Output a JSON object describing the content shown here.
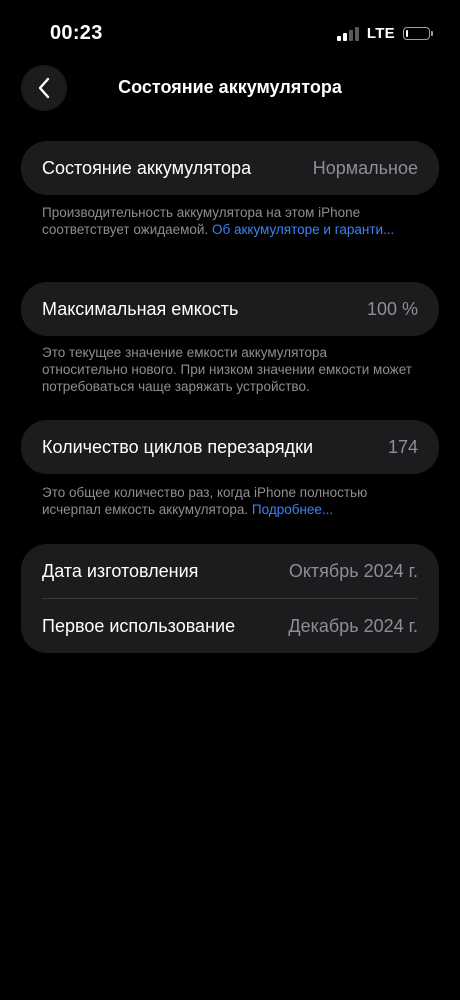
{
  "status_bar": {
    "time": "00:23",
    "network": "LTE"
  },
  "nav": {
    "title": "Состояние аккумулятора",
    "back_icon": "chevron-left-icon"
  },
  "battery_health": {
    "label": "Состояние аккумулятора",
    "value": "Нормальное",
    "footnote_text": "Производительность аккумулятора на этом iPhone соответствует ожидаемой. ",
    "footnote_link": "Об аккумуляторе и гаранти..."
  },
  "max_capacity": {
    "label": "Максимальная емкость",
    "value": "100 %",
    "footnote_text": "Это текущее значение емкости аккумулятора относительно нового. При низком значении емкости может потребоваться чаще заряжать устройство."
  },
  "cycle_count": {
    "label": "Количество циклов перезарядки",
    "value": "174",
    "footnote_text": "Это общее количество раз, когда iPhone полностью исчерпал емкость аккумулятора. ",
    "footnote_link": "Подробнее..."
  },
  "dates": {
    "manufacture_label": "Дата изготовления",
    "manufacture_value": "Октябрь 2024 г.",
    "first_use_label": "Первое использование",
    "first_use_value": "Декабрь 2024 г."
  },
  "colors": {
    "background": "#000000",
    "card": "#1c1c1e",
    "secondary_text": "#8e8e93",
    "link": "#3b82f6"
  }
}
